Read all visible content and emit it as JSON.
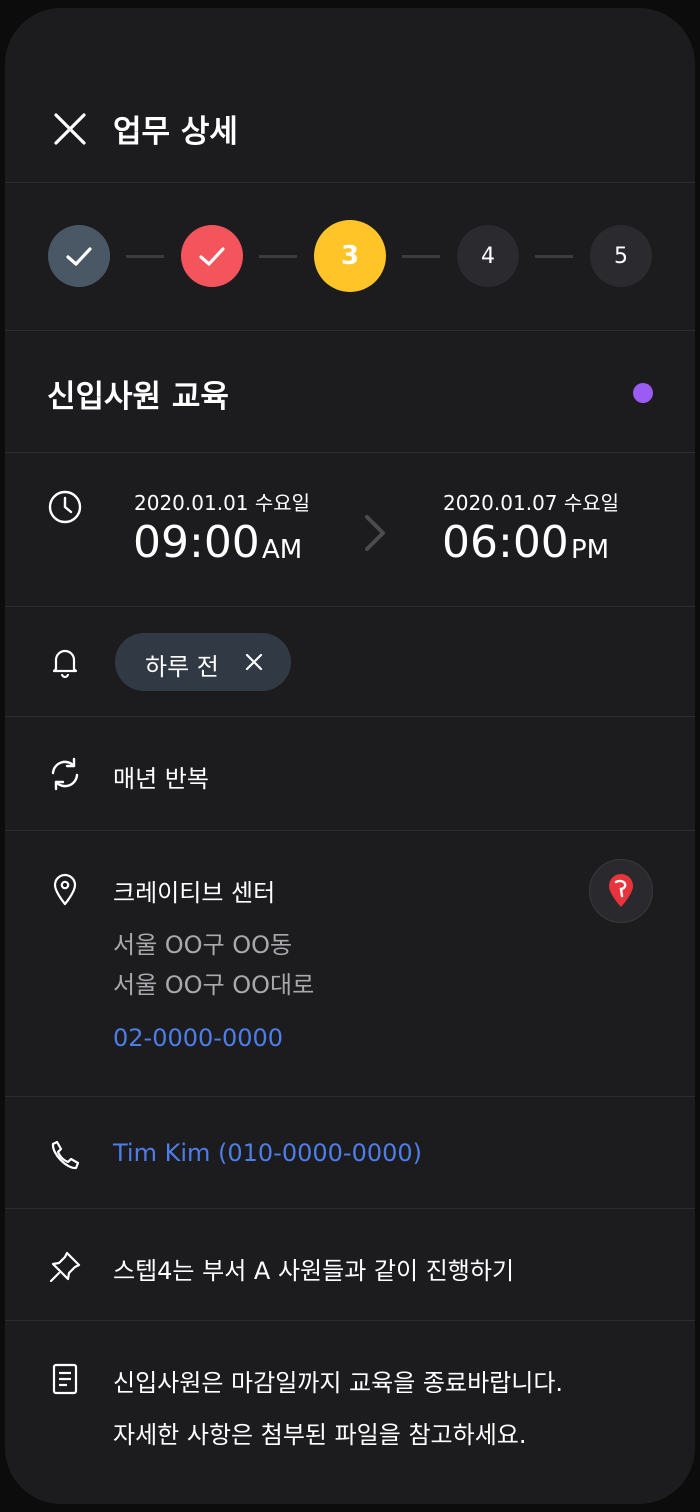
{
  "header": {
    "title": "업무 상세"
  },
  "stepper": {
    "steps": [
      "",
      "",
      "3",
      "4",
      "5"
    ],
    "current_step": 3
  },
  "event": {
    "title": "신입사원 교육",
    "color": "#9b5cf5"
  },
  "schedule": {
    "start_date": "2020.01.01 수요일",
    "start_time": "09:00",
    "start_ampm": "AM",
    "end_date": "2020.01.07 수요일",
    "end_time": "06:00",
    "end_ampm": "PM"
  },
  "reminder": {
    "chip_label": "하루 전"
  },
  "repeat": {
    "label": "매년 반복"
  },
  "location": {
    "name": "크레이티브 센터",
    "address_line1": "서울 OO구 OO동",
    "address_line2": "서울 OO구 OO대로",
    "phone": "02-0000-0000"
  },
  "contact": {
    "label": "Tim Kim (010-0000-0000)"
  },
  "note_pin": {
    "label": "스텝4는 부서 A 사원들과 같이 진행하기"
  },
  "memo": {
    "line1": "신입사원은 마감일까지 교육을 종료바랍니다.",
    "line2": "자세한 사항은 첨부된 파일을 참고하세요."
  },
  "colors": {
    "background": "#1c1c1f",
    "step_done": "#4a5866",
    "step_done_accent": "#f4545c",
    "step_current": "#ffc427",
    "link": "#4d7de8",
    "chip": "#313945"
  }
}
